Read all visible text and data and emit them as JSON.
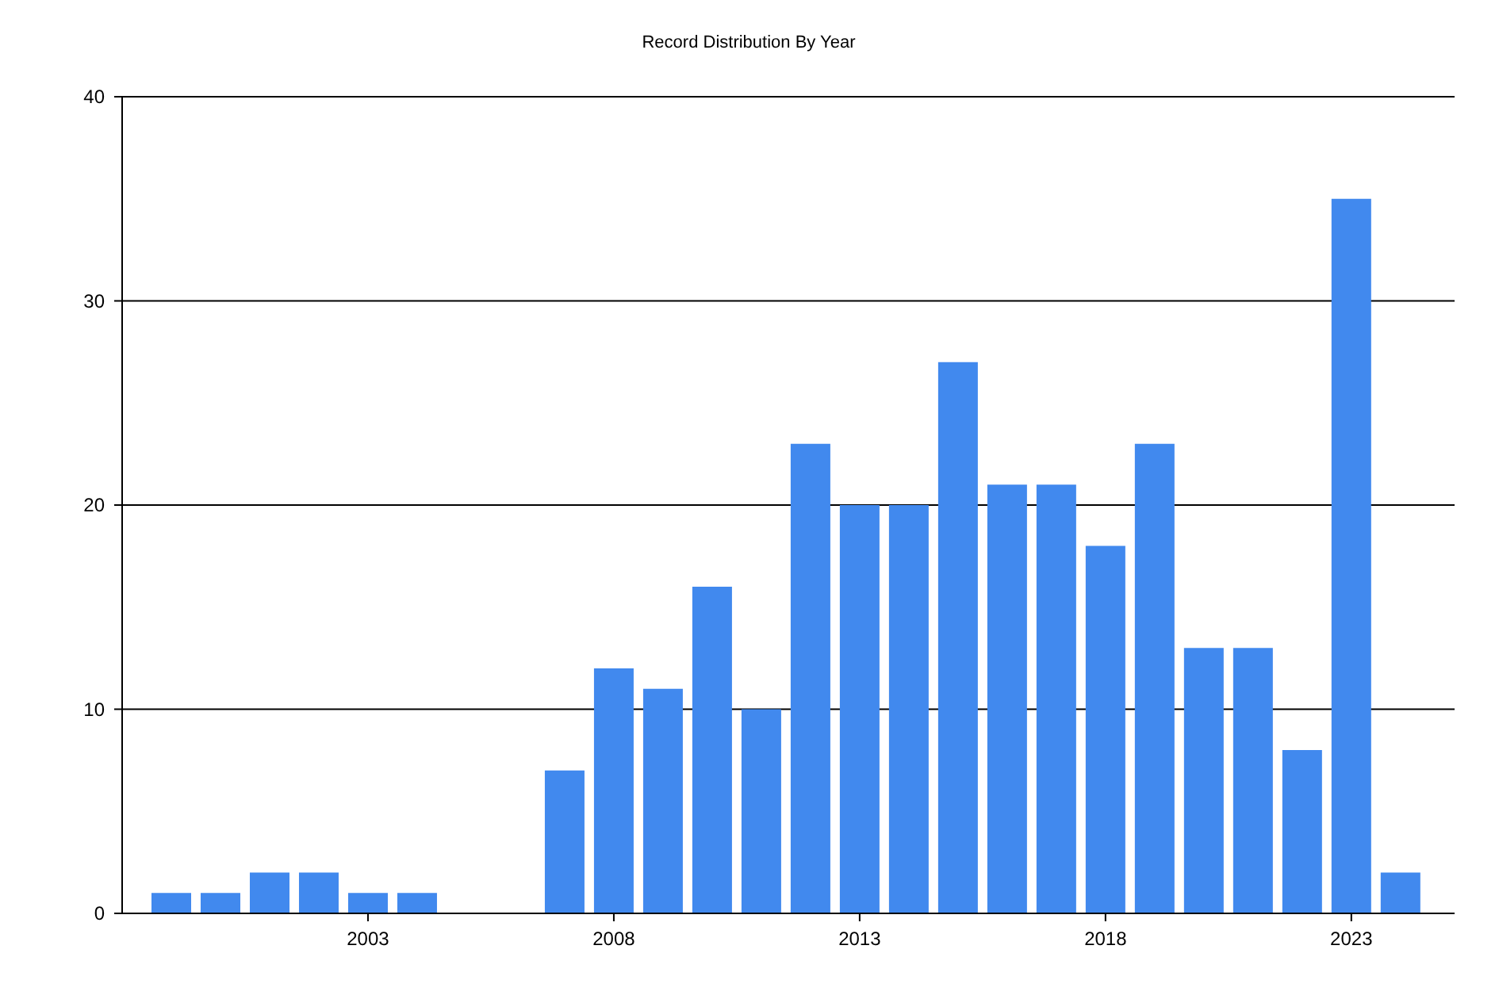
{
  "chart_data": {
    "type": "bar",
    "title": "Record Distribution By Year",
    "x": [
      1999,
      2000,
      2001,
      2002,
      2003,
      2004,
      2007,
      2008,
      2009,
      2010,
      2011,
      2012,
      2013,
      2014,
      2015,
      2016,
      2017,
      2018,
      2019,
      2020,
      2021,
      2022,
      2023,
      2024
    ],
    "values": [
      1,
      1,
      2,
      2,
      1,
      1,
      7,
      12,
      11,
      16,
      10,
      23,
      20,
      20,
      27,
      21,
      21,
      18,
      23,
      13,
      13,
      8,
      35,
      2
    ],
    "xlim": [
      1998,
      2025.1
    ],
    "ylim": [
      0,
      40
    ],
    "xticks": [
      2003,
      2008,
      2013,
      2018,
      2023
    ],
    "yticks": [
      0,
      10,
      20,
      30,
      40
    ],
    "grid": true
  }
}
